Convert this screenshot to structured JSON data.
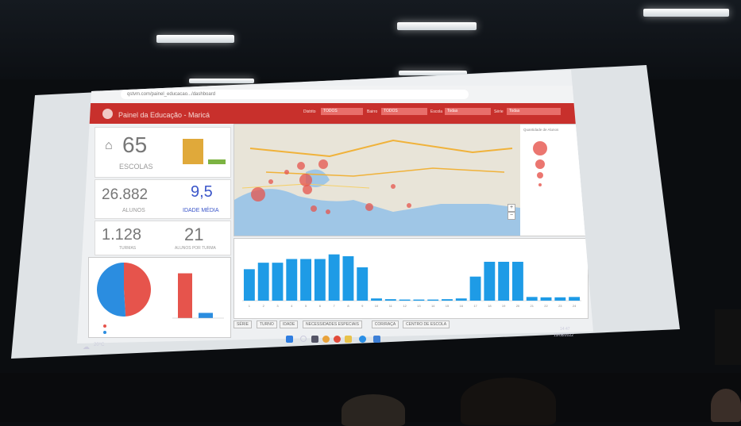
{
  "browser": {
    "url": "qstvm.com/painel_educacao.../dashboard"
  },
  "app": {
    "title": "Painel da Educação - Maricá"
  },
  "filters": [
    {
      "label": "Distrito",
      "value": "TODOS"
    },
    {
      "label": "Bairro",
      "value": "TODOS"
    },
    {
      "label": "Escola",
      "value": "Todas"
    },
    {
      "label": "Série",
      "value": "Todas"
    }
  ],
  "kpis": {
    "escolas": {
      "value": "65",
      "label": "ESCOLAS"
    },
    "alunos": {
      "value": "26.882",
      "label": "ALUNOS"
    },
    "idade": {
      "value": "9,5",
      "label": "IDADE MÉDIA"
    },
    "turmas": {
      "value": "1.128",
      "label": "TURMAS"
    },
    "alunos_turma": {
      "value": "21",
      "label": "ALUNOS POR TURMA"
    }
  },
  "map": {
    "legend_title": "Quantidade de Alunos"
  },
  "bottom_tabs": [
    "SÉRIE",
    "TURNO",
    "IDADE",
    "NECESSIDADES ESPECIAIS",
    "COR/RAÇA",
    "CENTRO DE ESCOLA"
  ],
  "clock": {
    "time": "14:47",
    "date": "19/08/2022"
  },
  "weather": {
    "temp": "20°C"
  },
  "chart_data": {
    "type": "bar",
    "categories": [
      "1",
      "2",
      "3",
      "4",
      "5",
      "6",
      "7",
      "8",
      "9",
      "10",
      "11",
      "12",
      "13",
      "14",
      "15",
      "16",
      "17",
      "18",
      "19",
      "20",
      "21",
      "22",
      "23",
      "24"
    ],
    "values": [
      1700,
      2050,
      2050,
      2250,
      2250,
      2250,
      2500,
      2400,
      1800,
      120,
      80,
      60,
      60,
      60,
      80,
      120,
      1300,
      2100,
      2100,
      2100,
      200,
      180,
      180,
      200
    ],
    "ylim": [
      0,
      3000
    ],
    "color": "#1e9be6"
  },
  "gender_pie": {
    "values": [
      49,
      51
    ],
    "colors": [
      "#e6544c",
      "#2b8de0"
    ]
  },
  "gender_bars": {
    "values": [
      3000,
      350
    ],
    "colors": [
      "#e6544c",
      "#2b8de0"
    ],
    "ylim": [
      0,
      3400
    ]
  },
  "accent": "#c8302c"
}
